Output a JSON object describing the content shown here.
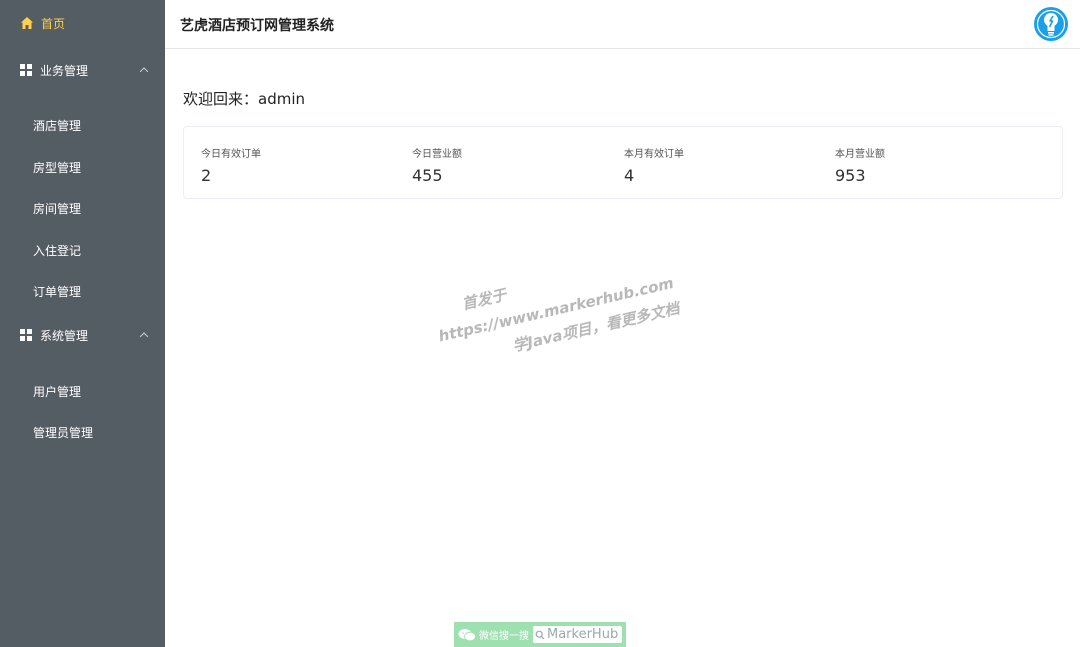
{
  "sidebar": {
    "home": "首页",
    "business": {
      "label": "业务管理",
      "items": [
        "酒店管理",
        "房型管理",
        "房间管理",
        "入住登记",
        "订单管理"
      ]
    },
    "system": {
      "label": "系统管理",
      "items": [
        "用户管理",
        "管理员管理"
      ]
    }
  },
  "header": {
    "title": "艺虎酒店预订网管理系统"
  },
  "main": {
    "welcome": "欢迎回来：admin",
    "stats": [
      {
        "label": "今日有效订单",
        "value": "2"
      },
      {
        "label": "今日营业额",
        "value": "455"
      },
      {
        "label": "本月有效订单",
        "value": "4"
      },
      {
        "label": "本月营业额",
        "value": "953"
      }
    ]
  },
  "watermark": {
    "line1": "首发于",
    "line2": "https://www.markerhub.com",
    "line3": "学Java项目，看更多文档"
  },
  "badge": {
    "prefix": "微信搜一搜",
    "name": "MarkerHub"
  },
  "colors": {
    "sidebar_bg": "#545c64",
    "active": "#ffd04b",
    "avatar": "#1aa0e8"
  }
}
